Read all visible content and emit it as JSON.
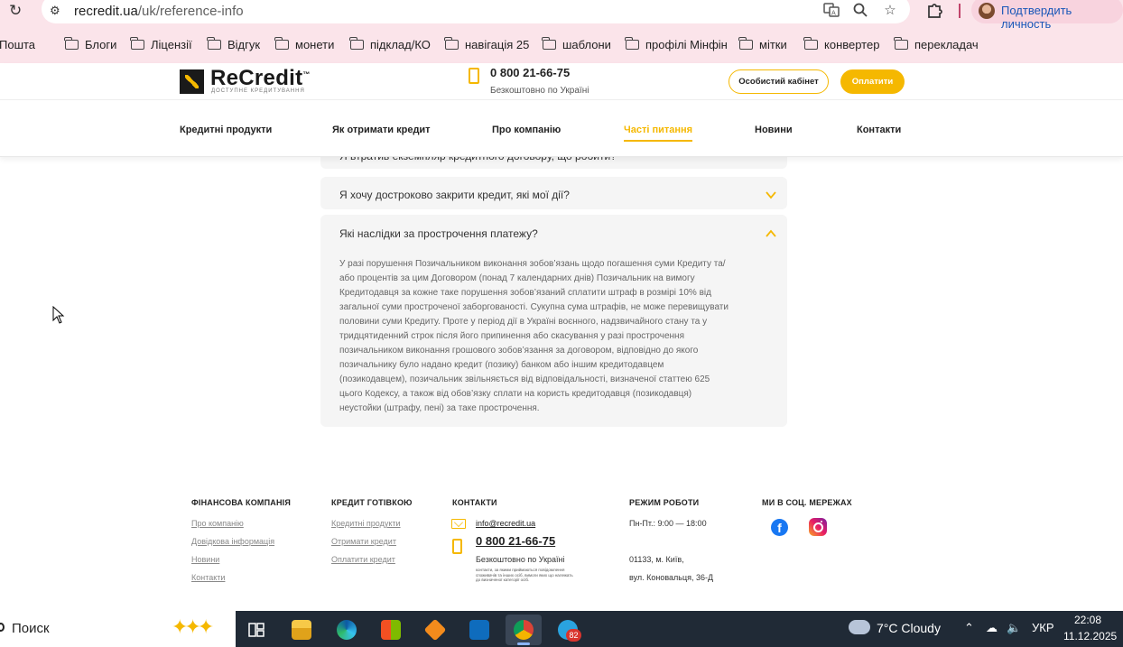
{
  "browser": {
    "url_host": "recredit.ua",
    "url_path": "/uk/reference-info",
    "profile_label": "Подтвердить личность",
    "accent_color": "#fbe4ea",
    "bookmarks": [
      "Пошта",
      "Блоги",
      "Ліцензії",
      "Відгук",
      "монети",
      "підклад/КО",
      "навігація 25",
      "шаблони",
      "профілі Мінфін",
      "мітки",
      "конвертер",
      "перекладач"
    ]
  },
  "header": {
    "logo_text": "ReCredit",
    "logo_tm": "™",
    "logo_sub": "ДОСТУПНЕ КРЕДИТУВАННЯ",
    "phone": "0 800 21-66-75",
    "phone_note": "Безкоштовно по Україні",
    "cabinet_label": "Особистий кабінет",
    "pay_label": "Оплатити",
    "brand_color": "#f5b800",
    "nav": [
      "Кредитні продукти",
      "Як отримати кредит",
      "Про компанію",
      "Часті питання",
      "Новини",
      "Контакти"
    ],
    "active_nav": "Часті питання"
  },
  "faq": {
    "partial_question": "Я втратив екземпляр кредитного договору, що робити?",
    "items": [
      {
        "question": "Я хочу достроково закрити кредит, які мої дії?",
        "expanded": false
      },
      {
        "question": "Які наслідки за прострочення платежу?",
        "expanded": true,
        "answer_lines": [
          "У разі порушення Позичальником виконання зобов’язань щодо погашення суми Кредиту та/",
          "або процентів за цим Договором (понад 7 календарних днів) Позичальник на вимогу",
          "Кредитодавця за кожне таке порушення зобов’язаний сплатити штраф в розмірі 10% від",
          "загальної суми простроченої заборгованості. Сукупна сума штрафів, не може перевищувати",
          "половини суми Кредиту. Проте у період дії в Україні воєнного, надзвичайного стану та у",
          "тридцятиденний строк після його припинення або скасування у разі прострочення",
          "позичальником виконання грошового зобов’язання за договором, відповідно до якого",
          "позичальнику було надано кредит (позику) банком або іншим кредитодавцем",
          "(позикодавцем), позичальник звільняється від відповідальності, визначеної статтею 625",
          "цього Кодексу, а також від обов’язку сплати на користь кредитодавця (позикодавця)",
          "неустойки (штрафу, пені) за таке прострочення."
        ]
      }
    ]
  },
  "footer": {
    "col1": {
      "heading": "ФІНАНСОВА КОМПАНІЯ",
      "links": [
        "Про компанію",
        "Довідкова інформація",
        "Новини",
        "Контакти"
      ]
    },
    "col2": {
      "heading": "КРЕДИТ ГОТІВКОЮ",
      "links": [
        "Кредитні продукти",
        "Отримати кредит",
        "Оплатити кредит"
      ]
    },
    "contacts": {
      "heading": "КОНТАКТИ",
      "email": "info@recredit.ua",
      "phone": "0 800 21-66-75",
      "phone_note": "Безкоштовно по Україні",
      "tiny_note": "контакти, за якими приймаються повідомлення споживачів та інших осіб, вимоги яких що належать до визначеної категорії осіб."
    },
    "hours": {
      "heading": "РЕЖИМ РОБОТИ",
      "schedule": "Пн-Пт.: 9:00 — 18:00",
      "address_line1": "01133, м. Київ,",
      "address_line2": "вул. Коновальця, 36-Д"
    },
    "social": {
      "heading": "МИ В СОЦ. МЕРЕЖАХ",
      "icons": [
        "facebook-icon",
        "instagram-icon"
      ]
    }
  },
  "taskbar": {
    "search_label": "Поиск",
    "weather": "7°C  Cloudy",
    "language": "УКР",
    "time": "22:08",
    "date": "11.12.2025",
    "telegram_badge": "82"
  }
}
